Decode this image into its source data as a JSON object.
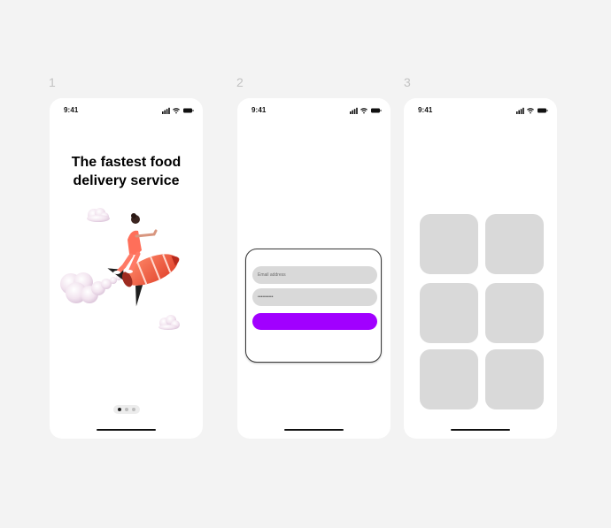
{
  "frames": [
    {
      "number": "1",
      "time": "9:41",
      "headline_line1": "The fastest food",
      "headline_line2": "delivery service",
      "pagination": {
        "count": 3,
        "active_index": 0
      }
    },
    {
      "number": "2",
      "time": "9:41",
      "login": {
        "email_placeholder": "Email address",
        "password_value": "••••••••••"
      }
    },
    {
      "number": "3",
      "time": "9:41",
      "grid": {
        "rows": 3,
        "cols": 2
      }
    }
  ],
  "colors": {
    "background": "#f3f3f3",
    "accent": "#a100ff",
    "placeholder_tile": "#d9d9d9"
  },
  "icons": [
    "cellular-signal-icon",
    "wifi-icon",
    "battery-icon"
  ]
}
